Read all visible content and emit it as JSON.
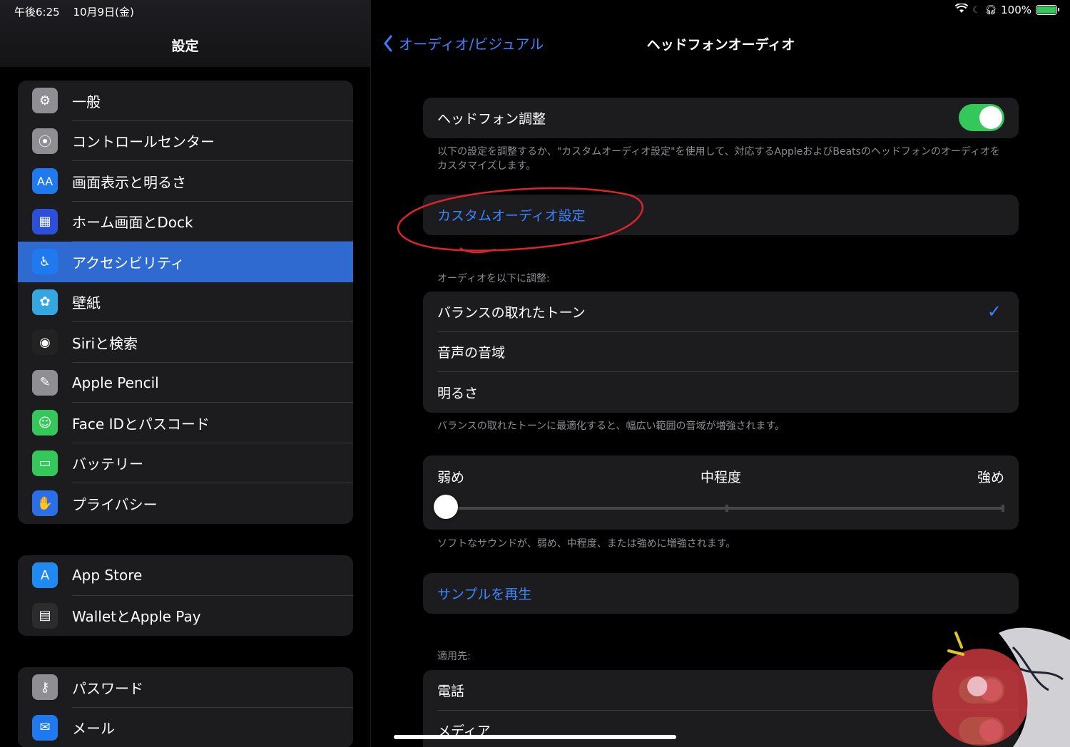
{
  "status": {
    "time": "午後6:25",
    "date": "10月9日(金)",
    "battery": "100%"
  },
  "sidebar": {
    "title": "設定",
    "group1": [
      {
        "label": "一般",
        "icon": "gear-icon",
        "color": "#8e8e93"
      },
      {
        "label": "コントロールセンター",
        "icon": "switches-icon",
        "color": "#8e8e93"
      },
      {
        "label": "画面表示と明るさ",
        "icon": "text-size-icon",
        "color": "#1f7aef"
      },
      {
        "label": "ホーム画面とDock",
        "icon": "grid-icon",
        "color": "#2b4fd8"
      },
      {
        "label": "アクセシビリティ",
        "icon": "accessibility-icon",
        "color": "#1f7aef"
      },
      {
        "label": "壁紙",
        "icon": "flower-icon",
        "color": "#35a7e0"
      },
      {
        "label": "Siriと検索",
        "icon": "siri-icon",
        "color": "#222"
      },
      {
        "label": "Apple Pencil",
        "icon": "pencil-icon",
        "color": "#8e8e93"
      },
      {
        "label": "Face IDとパスコード",
        "icon": "face-id-icon",
        "color": "#34c759"
      },
      {
        "label": "バッテリー",
        "icon": "battery-icon",
        "color": "#34c759"
      },
      {
        "label": "プライバシー",
        "icon": "hand-icon",
        "color": "#2b6fe8"
      }
    ],
    "group2": [
      {
        "label": "App Store",
        "icon": "app-store-icon",
        "color": "#1f8bf2"
      },
      {
        "label": "WalletとApple Pay",
        "icon": "wallet-icon",
        "color": "#2c2c2e"
      }
    ],
    "group3": [
      {
        "label": "パスワード",
        "icon": "key-icon",
        "color": "#8e8e93"
      },
      {
        "label": "メール",
        "icon": "mail-icon",
        "color": "#1f7aef"
      }
    ],
    "selected_index": 4
  },
  "detail": {
    "back_label": "オーディオ/ビジュアル",
    "title": "ヘッドフォンオーディオ",
    "headphone_adjust": "ヘッドフォン調整",
    "headphone_note": "以下の設定を調整するか、\"カスタムオーディオ設定\"を使用して、対応するAppleおよびBeatsのヘッドフォンのオーディオをカスタマイズします。",
    "custom_setting": "カスタムオーディオ設定",
    "tune_header": "オーディオを以下に調整:",
    "tune_options": [
      "バランスの取れたトーン",
      "音声の音域",
      "明るさ"
    ],
    "tune_note": "バランスの取れたトーンに最適化すると、幅広い範囲の音域が増強されます。",
    "slider": {
      "min_label": "弱め",
      "mid_label": "中程度",
      "max_label": "強め",
      "value": 0
    },
    "slider_note": "ソフトなサウンドが、弱め、中程度、または強めに増強されます。",
    "play_sample": "サンプルを再生",
    "apply_header": "適用先:",
    "apply_items": [
      "電話",
      "メディア"
    ]
  },
  "colors": {
    "accent": "#3a84ff",
    "selected": "#2f6ad0",
    "toggle_on": "#34c759",
    "card": "#1c1c1e"
  }
}
